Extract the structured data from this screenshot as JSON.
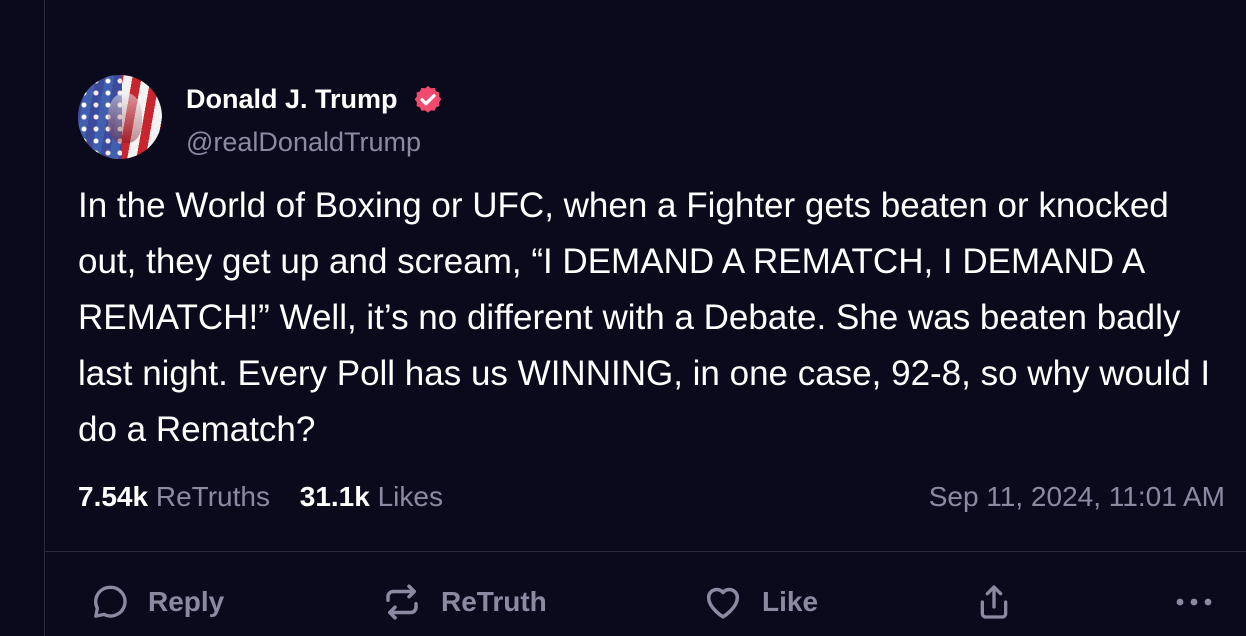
{
  "author": {
    "display_name": "Donald J. Trump",
    "handle": "@realDonaldTrump",
    "verified": true,
    "verified_color": "#f04a6f"
  },
  "post": {
    "text": "In the World of Boxing or UFC, when a Fighter gets beaten or knocked out, they get up and scream, “I DEMAND A REMATCH, I DEMAND A REMATCH!” Well, it’s no different with a Debate. She was beaten badly last night. Every Poll has us WINNING, in one case, 92-8, so why would I do a Rematch?",
    "retruths_count": "7.54k",
    "retruths_label": "ReTruths",
    "likes_count": "31.1k",
    "likes_label": "Likes",
    "timestamp": "Sep 11, 2024, 11:01 AM"
  },
  "actions": {
    "reply": {
      "label": "Reply",
      "icon": "speech-bubble-icon"
    },
    "retruth": {
      "label": "ReTruth",
      "icon": "repost-arrows-icon"
    },
    "like": {
      "label": "Like",
      "icon": "heart-icon"
    },
    "share": {
      "icon": "share-icon"
    },
    "more": {
      "icon": "more-dots-icon"
    }
  },
  "colors": {
    "background": "#0b0a1d",
    "text_primary": "#ffffff",
    "text_secondary": "#8b8aa2",
    "divider": "#2a2940"
  }
}
